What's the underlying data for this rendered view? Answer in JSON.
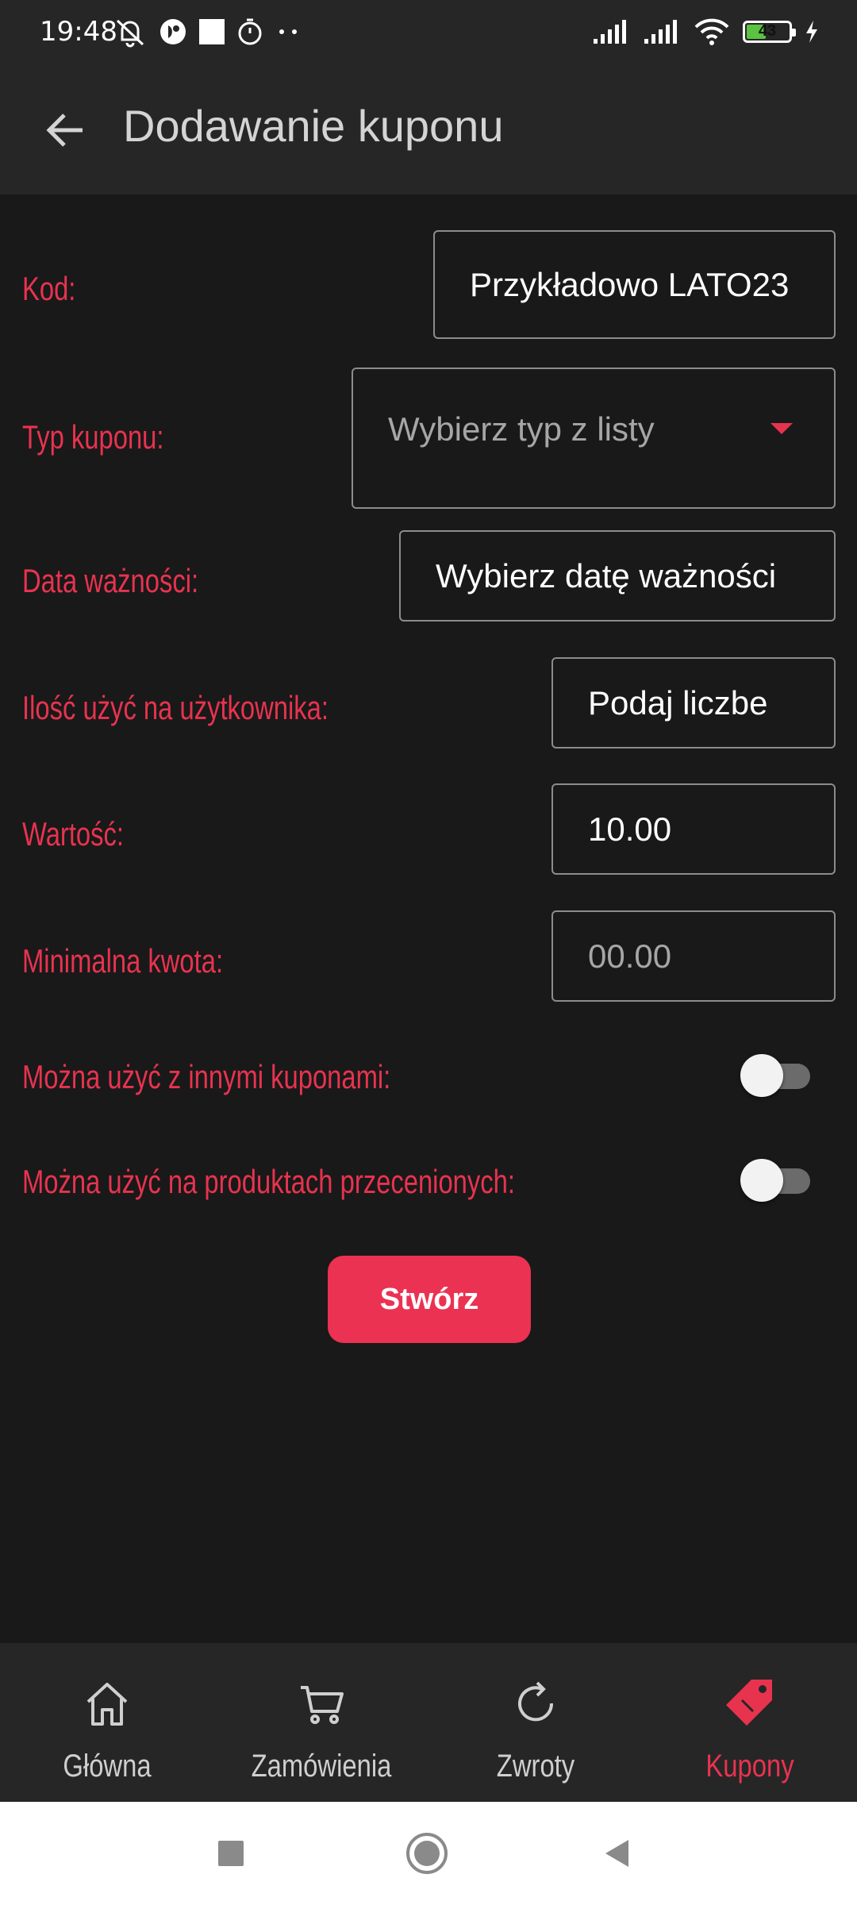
{
  "status": {
    "time": "19:48",
    "battery": "43",
    "battery_level_percent": 43
  },
  "header": {
    "title": "Dodawanie kuponu"
  },
  "form": {
    "code": {
      "label": "Kod:",
      "value": "Przykładowo LATO23"
    },
    "type": {
      "label": "Typ kuponu:",
      "value": "Wybierz typ z listy"
    },
    "expiry": {
      "label": "Data ważności:",
      "value": "Wybierz datę ważności"
    },
    "uses": {
      "label": "Ilość użyć na użytkownika:",
      "value": "Podaj liczbe"
    },
    "amount": {
      "label": "Wartość:",
      "value": "10.00"
    },
    "min_amount": {
      "label": "Minimalna kwota:",
      "value": "00.00"
    },
    "combine": {
      "label": "Można użyć z innymi kuponami:",
      "on": false
    },
    "discounted": {
      "label": "Można użyć na produktach przecenionych:",
      "on": false
    },
    "submit_label": "Stwórz"
  },
  "nav": {
    "items": [
      {
        "label": "Główna",
        "icon": "home-icon"
      },
      {
        "label": "Zamówienia",
        "icon": "cart-icon"
      },
      {
        "label": "Zwroty",
        "icon": "refresh-icon"
      },
      {
        "label": "Kupony",
        "icon": "tag-icon",
        "active": true
      }
    ]
  },
  "colors": {
    "accent": "#eb3252",
    "background": "#191919",
    "bar": "#262626"
  }
}
